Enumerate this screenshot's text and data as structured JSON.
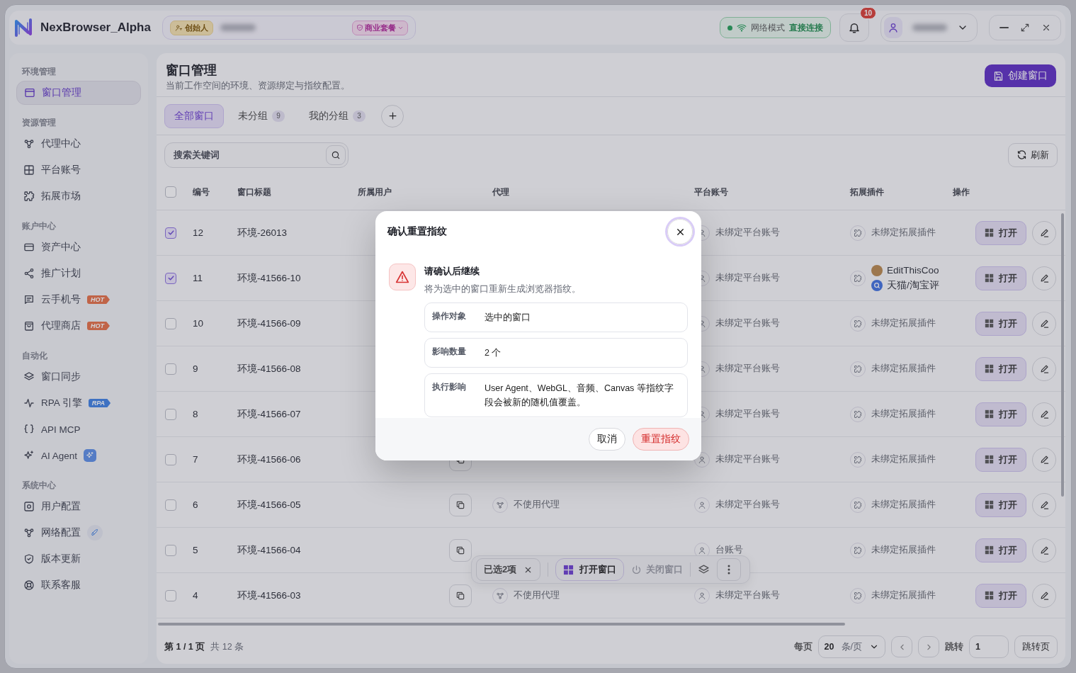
{
  "app": {
    "name": "NexBrowser_Alpha"
  },
  "workspace": {
    "role": "创始人",
    "plan": "商业套餐"
  },
  "network": {
    "label": "网络模式",
    "value": "直接连接",
    "online": true
  },
  "notifications": {
    "count": "10"
  },
  "sidebar": {
    "sections": [
      {
        "title": "环境管理",
        "items": [
          {
            "label": "窗口管理",
            "selected": true
          }
        ]
      },
      {
        "title": "资源管理",
        "items": [
          {
            "label": "代理中心",
            "selected": false
          },
          {
            "label": "平台账号",
            "selected": false
          },
          {
            "label": "拓展市场",
            "selected": false
          }
        ]
      },
      {
        "title": "账户中心",
        "items": [
          {
            "label": "资产中心",
            "selected": false
          },
          {
            "label": "推广计划",
            "selected": false
          },
          {
            "label": "云手机号",
            "selected": false,
            "badge": {
              "kind": "hot",
              "text": "HOT"
            }
          },
          {
            "label": "代理商店",
            "selected": false,
            "badge": {
              "kind": "hot",
              "text": "HOT"
            }
          }
        ]
      },
      {
        "title": "自动化",
        "items": [
          {
            "label": "窗口同步",
            "selected": false
          },
          {
            "label": "RPA 引擎",
            "selected": false,
            "badge": {
              "kind": "rpa",
              "text": "RPA"
            }
          },
          {
            "label": "API MCP",
            "selected": false
          },
          {
            "label": "AI Agent",
            "selected": false,
            "badge": {
              "kind": "ai"
            }
          }
        ]
      },
      {
        "title": "系统中心",
        "items": [
          {
            "label": "用户配置",
            "selected": false
          },
          {
            "label": "网络配置",
            "selected": false,
            "badge": {
              "kind": "rocket"
            }
          },
          {
            "label": "版本更新",
            "selected": false
          },
          {
            "label": "联系客服",
            "selected": false
          }
        ]
      }
    ]
  },
  "page": {
    "title": "窗口管理",
    "subtitle": "当前工作空间的环境、资源绑定与指纹配置。",
    "create_button": "创建窗口"
  },
  "tabs": [
    {
      "label": "全部窗口",
      "selected": true
    },
    {
      "label": "未分组",
      "count": "9",
      "selected": false
    },
    {
      "label": "我的分组",
      "count": "3",
      "selected": false
    }
  ],
  "search": {
    "placeholder": "搜索关键词"
  },
  "refresh_button": "刷新",
  "table": {
    "select_all": false,
    "columns": [
      "编号",
      "窗口标题",
      "所属用户",
      "代理",
      "平台账号",
      "拓展插件",
      "操作"
    ],
    "rows": [
      {
        "checked": true,
        "id": "12",
        "title": "环境-26013",
        "platform": "未绑定平台账号",
        "plugin": "未绑定拓展插件",
        "open_button": "打开"
      },
      {
        "checked": true,
        "id": "11",
        "title": "环境-41566-10",
        "platform": "未绑定平台账号",
        "plugins": [
          {
            "kind": "cookie",
            "name": "EditThisCoo"
          },
          {
            "kind": "search",
            "name": "天猫/淘宝评"
          }
        ],
        "open_button": "打开"
      },
      {
        "checked": false,
        "id": "10",
        "title": "环境-41566-09",
        "platform": "未绑定平台账号",
        "plugin": "未绑定拓展插件",
        "open_button": "打开"
      },
      {
        "checked": false,
        "id": "9",
        "title": "环境-41566-08",
        "platform": "未绑定平台账号",
        "plugin": "未绑定拓展插件",
        "open_button": "打开"
      },
      {
        "checked": false,
        "id": "8",
        "title": "环境-41566-07",
        "platform": "未绑定平台账号",
        "plugin": "未绑定拓展插件",
        "open_button": "打开"
      },
      {
        "checked": false,
        "id": "7",
        "title": "环境-41566-06",
        "copy_button": true,
        "platform": "未绑定平台账号",
        "plugin": "未绑定拓展插件",
        "open_button": "打开"
      },
      {
        "checked": false,
        "id": "6",
        "title": "环境-41566-05",
        "copy_button": true,
        "proxy": "不使用代理",
        "platform": "未绑定平台账号",
        "plugin": "未绑定拓展插件",
        "open_button": "打开"
      },
      {
        "checked": false,
        "id": "5",
        "title": "环境-41566-04",
        "copy_button": true,
        "platform": "台账号",
        "plugin": "未绑定拓展插件",
        "open_button": "打开"
      },
      {
        "checked": false,
        "id": "4",
        "title": "环境-41566-03",
        "copy_button": true,
        "proxy": "不使用代理",
        "platform": "未绑定平台账号",
        "plugin": "未绑定拓展插件",
        "open_button": "打开"
      }
    ]
  },
  "footer": {
    "page": "第 1 / 1 页",
    "total": "共 12 条",
    "per_page_label": "每页",
    "per_page": "20",
    "per_page_unit": "条/页",
    "jump_label": "跳转",
    "jump_value": "1",
    "jump_button": "跳转页"
  },
  "selection_bar": {
    "count": "已选2项",
    "open": "打开窗口",
    "close": "关闭窗口",
    "close_disabled": true
  },
  "dialog": {
    "title": "确认重置指纹",
    "heading": "请确认后继续",
    "message": "将为选中的窗口重新生成浏览器指纹。",
    "details": [
      {
        "label": "操作对象",
        "value": "选中的窗口"
      },
      {
        "label": "影响数量",
        "value": "2 个"
      },
      {
        "label": "执行影响",
        "value": "User Agent、WebGL、音频、Canvas 等指纹字段会被新的随机值覆盖。"
      }
    ],
    "cancel": "取消",
    "confirm": "重置指纹"
  }
}
